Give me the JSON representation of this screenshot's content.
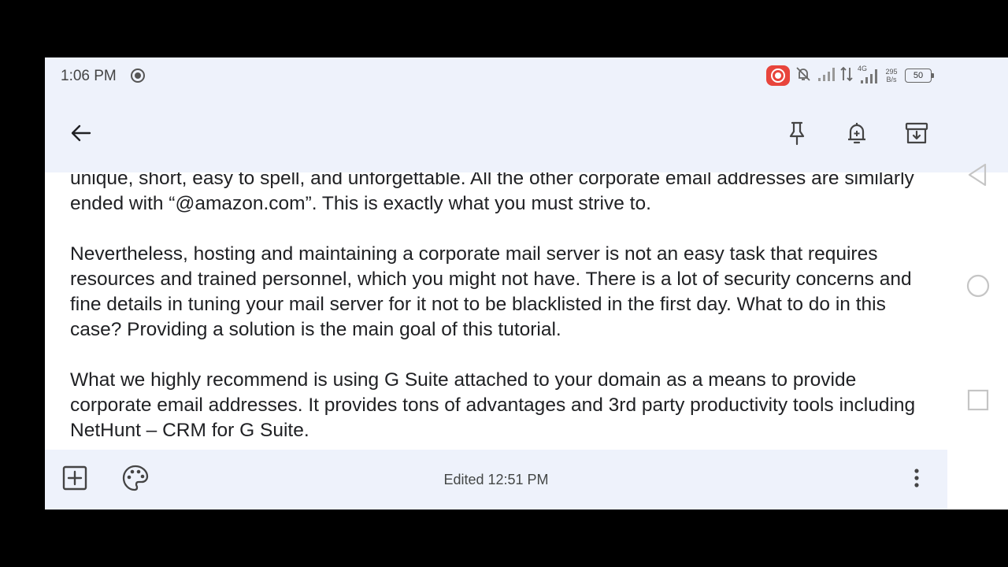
{
  "status": {
    "time": "1:06 PM",
    "net_speed_value": "295",
    "net_speed_unit": "B/s",
    "network_type": "4G",
    "battery": "50"
  },
  "note": {
    "paragraphs": [
      "unique, short, easy to spell, and unforgettable. All the other corporate email addresses are similarly ended with “@amazon.com”. This is exactly what you must strive to.",
      "Nevertheless, hosting and maintaining a corporate mail server is not an easy task that requires resources and trained personnel, which you might not have. There is a lot of security concerns and fine details in tuning your mail server for it not to be blacklisted in the first day. What to do in this case? Providing a solution is the main goal of this tutorial.",
      "What we highly recommend is using G Suite attached to your domain as a means to provide corporate email addresses. It provides tons of advantages and 3rd party productivity tools including NetHunt – CRM for G Suite."
    ]
  },
  "bottom": {
    "edited": "Edited 12:51 PM"
  },
  "colors": {
    "bar_background": "#eef2fb",
    "text": "#202124",
    "record_badge": "#e8453c"
  }
}
